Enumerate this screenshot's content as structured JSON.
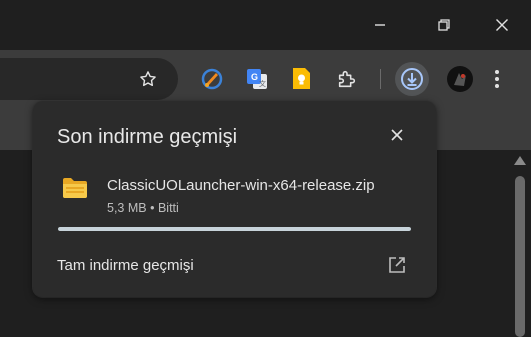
{
  "window": {
    "controls": [
      "minimize-icon",
      "restore-icon",
      "close-icon"
    ]
  },
  "toolbar": {
    "icons": [
      "bookmark-star-icon",
      "extension-orange-brush-icon",
      "google-translate-icon",
      "google-keep-icon",
      "extensions-puzzle-icon",
      "downloads-icon",
      "profile-avatar"
    ],
    "accent": "#a8c7fa"
  },
  "downloads_panel": {
    "title": "Son indirme geçmişi",
    "items": [
      {
        "file_name": "ClassicUOLauncher-win-x64-release.zip",
        "size": "5,3 MB",
        "status": "Bitti",
        "progress": 1.0,
        "icon": "zip-folder-icon"
      }
    ],
    "full_history_link": "Tam indirme geçmişi"
  }
}
